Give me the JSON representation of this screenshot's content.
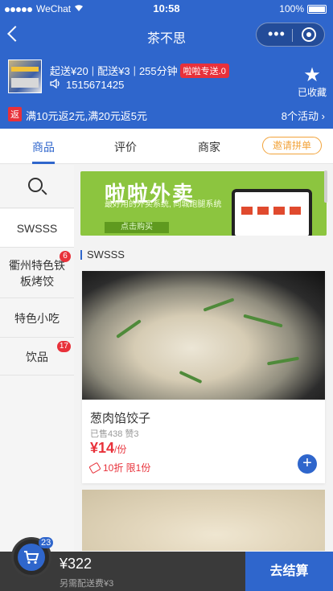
{
  "status_bar": {
    "carrier": "WeChat",
    "time": "10:58",
    "battery": "100%"
  },
  "nav": {
    "title": "茶不思",
    "more_icon": "more-dots-icon",
    "target_icon": "target-icon"
  },
  "shop": {
    "min_order": "起送¥20",
    "delivery_fee": "配送¥3",
    "delivery_time": "255分钟",
    "delivery_badge": "啦啦专送.0",
    "phone": "1515671425",
    "favorite_label": "已收藏"
  },
  "promo": {
    "tag": "返",
    "text": "满10元返2元,满20元返5元",
    "activities": "8个活动"
  },
  "tabs": [
    {
      "label": "商品"
    },
    {
      "label": "评价"
    },
    {
      "label": "商家"
    }
  ],
  "invite_label": "邀请拼单",
  "sidebar": {
    "items": [
      {
        "label": "SWSSS",
        "badge": ""
      },
      {
        "label": "衢州特色铁板烤饺",
        "badge": "6"
      },
      {
        "label": "特色小吃",
        "badge": ""
      },
      {
        "label": "饮品",
        "badge": "17"
      }
    ]
  },
  "banner": {
    "title": "啦啦外卖",
    "subtitle": "最好用的外卖系统, 同城跑腿系统",
    "button": "点击购买"
  },
  "section": {
    "title": "SWSSS"
  },
  "product": {
    "name": "葱肉馅饺子",
    "sales": "已售438 赞3",
    "price_symbol": "¥",
    "price": "14",
    "unit": "/份",
    "discount": "10折 限1份"
  },
  "cart": {
    "count": "23",
    "total": "¥322",
    "delivery_note": "另需配送费¥3",
    "checkout_label": "去结算"
  },
  "colors": {
    "primary": "#2f66cc",
    "red": "#e8313a",
    "orange": "#f2a33a"
  }
}
